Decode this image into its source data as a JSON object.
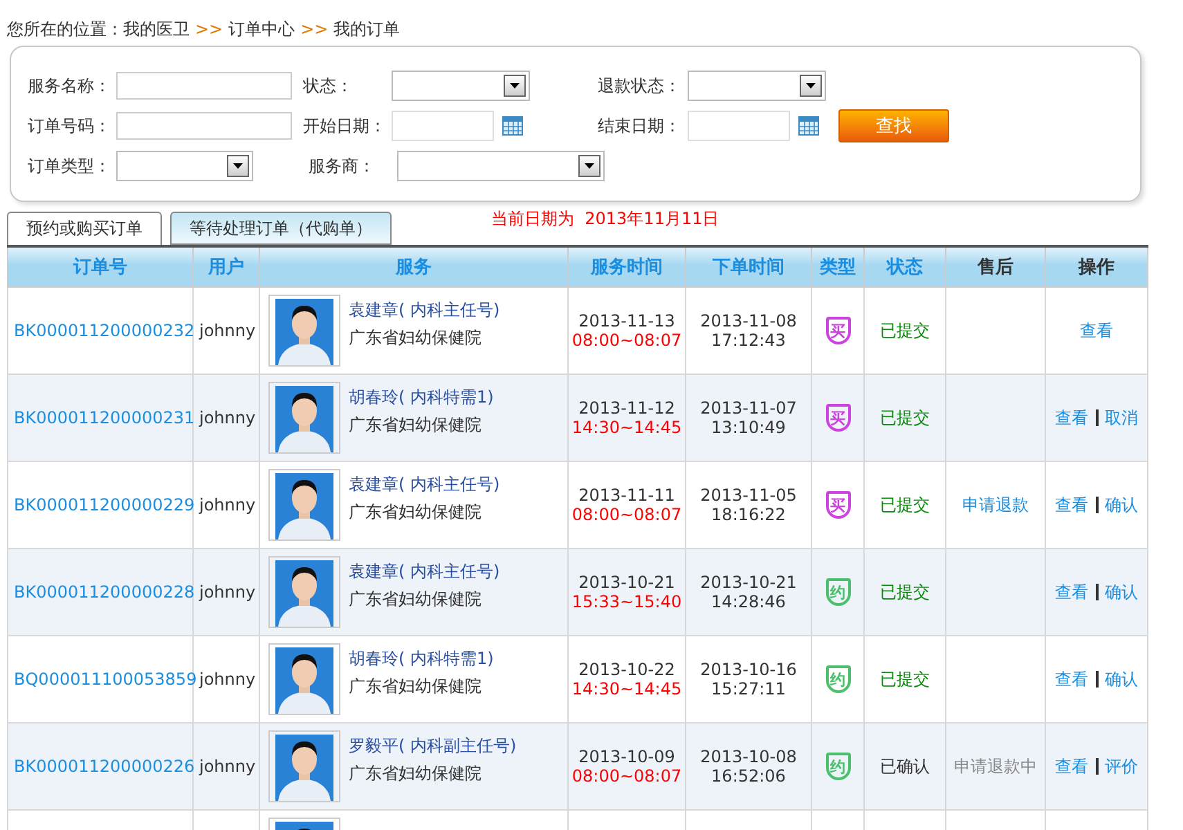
{
  "breadcrumb": [
    {
      "text": "您所在的位置：我的医卫"
    },
    {
      "text": ">>",
      "kind": "sep"
    },
    {
      "text": "订单中心"
    },
    {
      "text": ">>",
      "kind": "sep"
    },
    {
      "text": "我的订单"
    }
  ],
  "search": {
    "rows": [
      [
        {
          "label": "服务名称：",
          "kind": "text"
        },
        {
          "label": "状态：",
          "kind": "select"
        },
        {
          "label": "退款状态：",
          "kind": "select"
        }
      ],
      [
        {
          "label": "订单号码：",
          "kind": "text"
        },
        {
          "label": "开始日期：",
          "kind": "date"
        },
        {
          "label": "结束日期：",
          "kind": "date"
        }
      ],
      [
        {
          "label": "订单类型：",
          "kind": "select"
        },
        {
          "label": "服务商：",
          "kind": "wideselect"
        }
      ]
    ],
    "button": "查找"
  },
  "tabs": [
    {
      "label": "预约或购买订单",
      "selected": true
    },
    {
      "label": "等待处理订单（代购单）",
      "selected": false
    }
  ],
  "current_date": {
    "label": "当前日期为",
    "value": "2013年11月11日"
  },
  "table": {
    "columns": [
      {
        "label": "订单号",
        "color": "#1a8ee0"
      },
      {
        "label": "用户",
        "color": "#1a8ee0"
      },
      {
        "label": "服务",
        "color": "#1a8ee0"
      },
      {
        "label": "服务时间",
        "color": "#1a8ee0"
      },
      {
        "label": "下单时间",
        "color": "#1a8ee0"
      },
      {
        "label": "类型",
        "color": "#1a8ee0"
      },
      {
        "label": "状态",
        "color": "#1a8ee0"
      },
      {
        "label": "售后",
        "color": "#333333"
      },
      {
        "label": "操作",
        "color": "#333333"
      }
    ],
    "rows": [
      {
        "order": "BK000011200000232",
        "user": "johnny",
        "doctor": "袁建章( 内科主任号)",
        "hospital": "广东省妇幼保健院",
        "service_date": "2013-11-13",
        "service_time": "08:00~08:07",
        "order_date": "2013-11-08",
        "order_time": "17:12:43",
        "type": {
          "kind": "buy",
          "text": "买"
        },
        "status": {
          "kind": "submitted",
          "text": "已提交"
        },
        "actions": [
          "查看"
        ]
      },
      {
        "order": "BK000011200000231",
        "user": "johnny",
        "doctor": "胡春玲( 内科特需1)",
        "hospital": "广东省妇幼保健院",
        "service_date": "2013-11-12",
        "service_time": "14:30~14:45",
        "order_date": "2013-11-07",
        "order_time": "13:10:49",
        "type": {
          "kind": "buy",
          "text": "买"
        },
        "status": {
          "kind": "submitted",
          "text": "已提交"
        },
        "actions": [
          "查看",
          "取消"
        ]
      },
      {
        "order": "BK000011200000229",
        "user": "johnny",
        "doctor": "袁建章( 内科主任号)",
        "hospital": "广东省妇幼保健院",
        "service_date": "2013-11-11",
        "service_time": "08:00~08:07",
        "order_date": "2013-11-05",
        "order_time": "18:16:22",
        "type": {
          "kind": "buy",
          "text": "买"
        },
        "status": {
          "kind": "submitted",
          "text": "已提交"
        },
        "after_sale": {
          "kind": "link",
          "text": "申请退款"
        },
        "actions": [
          "查看",
          "确认"
        ]
      },
      {
        "order": "BK000011200000228",
        "user": "johnny",
        "doctor": "袁建章( 内科主任号)",
        "hospital": "广东省妇幼保健院",
        "service_date": "2013-10-21",
        "service_time": "15:33~15:40",
        "order_date": "2013-10-21",
        "order_time": "14:28:46",
        "type": {
          "kind": "appointment",
          "text": "约"
        },
        "status": {
          "kind": "submitted",
          "text": "已提交"
        },
        "actions": [
          "查看",
          "确认"
        ]
      },
      {
        "order": "BQ000011100053859",
        "user": "johnny",
        "doctor": "胡春玲( 内科特需1)",
        "hospital": "广东省妇幼保健院",
        "service_date": "2013-10-22",
        "service_time": "14:30~14:45",
        "order_date": "2013-10-16",
        "order_time": "15:27:11",
        "type": {
          "kind": "appointment",
          "text": "约"
        },
        "status": {
          "kind": "submitted",
          "text": "已提交"
        },
        "actions": [
          "查看",
          "确认"
        ]
      },
      {
        "order": "BK000011200000226",
        "user": "johnny",
        "doctor": "罗毅平( 内科副主任号)",
        "hospital": "广东省妇幼保健院",
        "service_date": "2013-10-09",
        "service_time": "08:00~08:07",
        "order_date": "2013-10-08",
        "order_time": "16:52:06",
        "type": {
          "kind": "appointment",
          "text": "约"
        },
        "status": {
          "kind": "confirmed",
          "text": "已确认"
        },
        "after_sale": {
          "kind": "pending",
          "text": "申请退款中"
        },
        "actions": [
          "查看",
          "评价"
        ]
      }
    ]
  }
}
